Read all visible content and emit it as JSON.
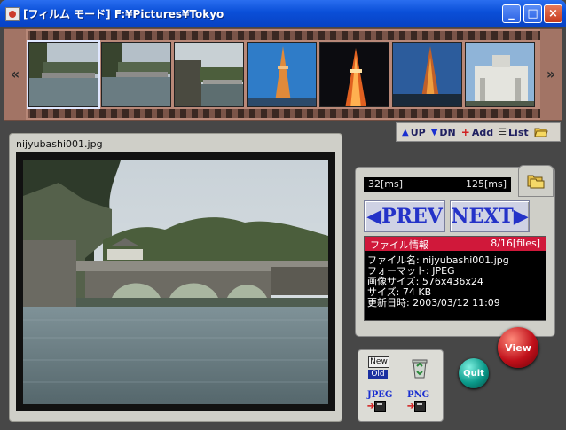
{
  "window": {
    "title": "[フィルム モード] F:¥Pictures¥Tokyo"
  },
  "filmstrip": {
    "left_arrow": "«",
    "right_arrow": "»"
  },
  "toolbar": {
    "up": "UP",
    "dn": "DN",
    "add": "Add",
    "list": "List"
  },
  "viewer": {
    "filename": "nijyubashi001.jpg"
  },
  "timing": {
    "left": "32[ms]",
    "right": "125[ms]"
  },
  "nav": {
    "prev": "◀PREV",
    "next": "NEXT▶"
  },
  "info": {
    "title": "ファイル情報",
    "count": "8/16[files]",
    "lines": [
      "ファイル名: nijyubashi001.jpg",
      "フォーマット: JPEG",
      "画像サイズ: 576x436x24",
      "サイズ: 74 KB",
      "更新日時: 2003/03/12 11:09"
    ]
  },
  "buttons": {
    "view": "View",
    "quit": "Quit",
    "new": "New",
    "old": "Old",
    "jpeg": "JPEG",
    "png": "PNG"
  },
  "colors": {
    "titlebar": "#0a4fd8",
    "film": "#b88878",
    "info_header": "#d0183a",
    "nav_text": "#2432c8",
    "view": "#c0101a",
    "quit": "#0a9a8a"
  }
}
